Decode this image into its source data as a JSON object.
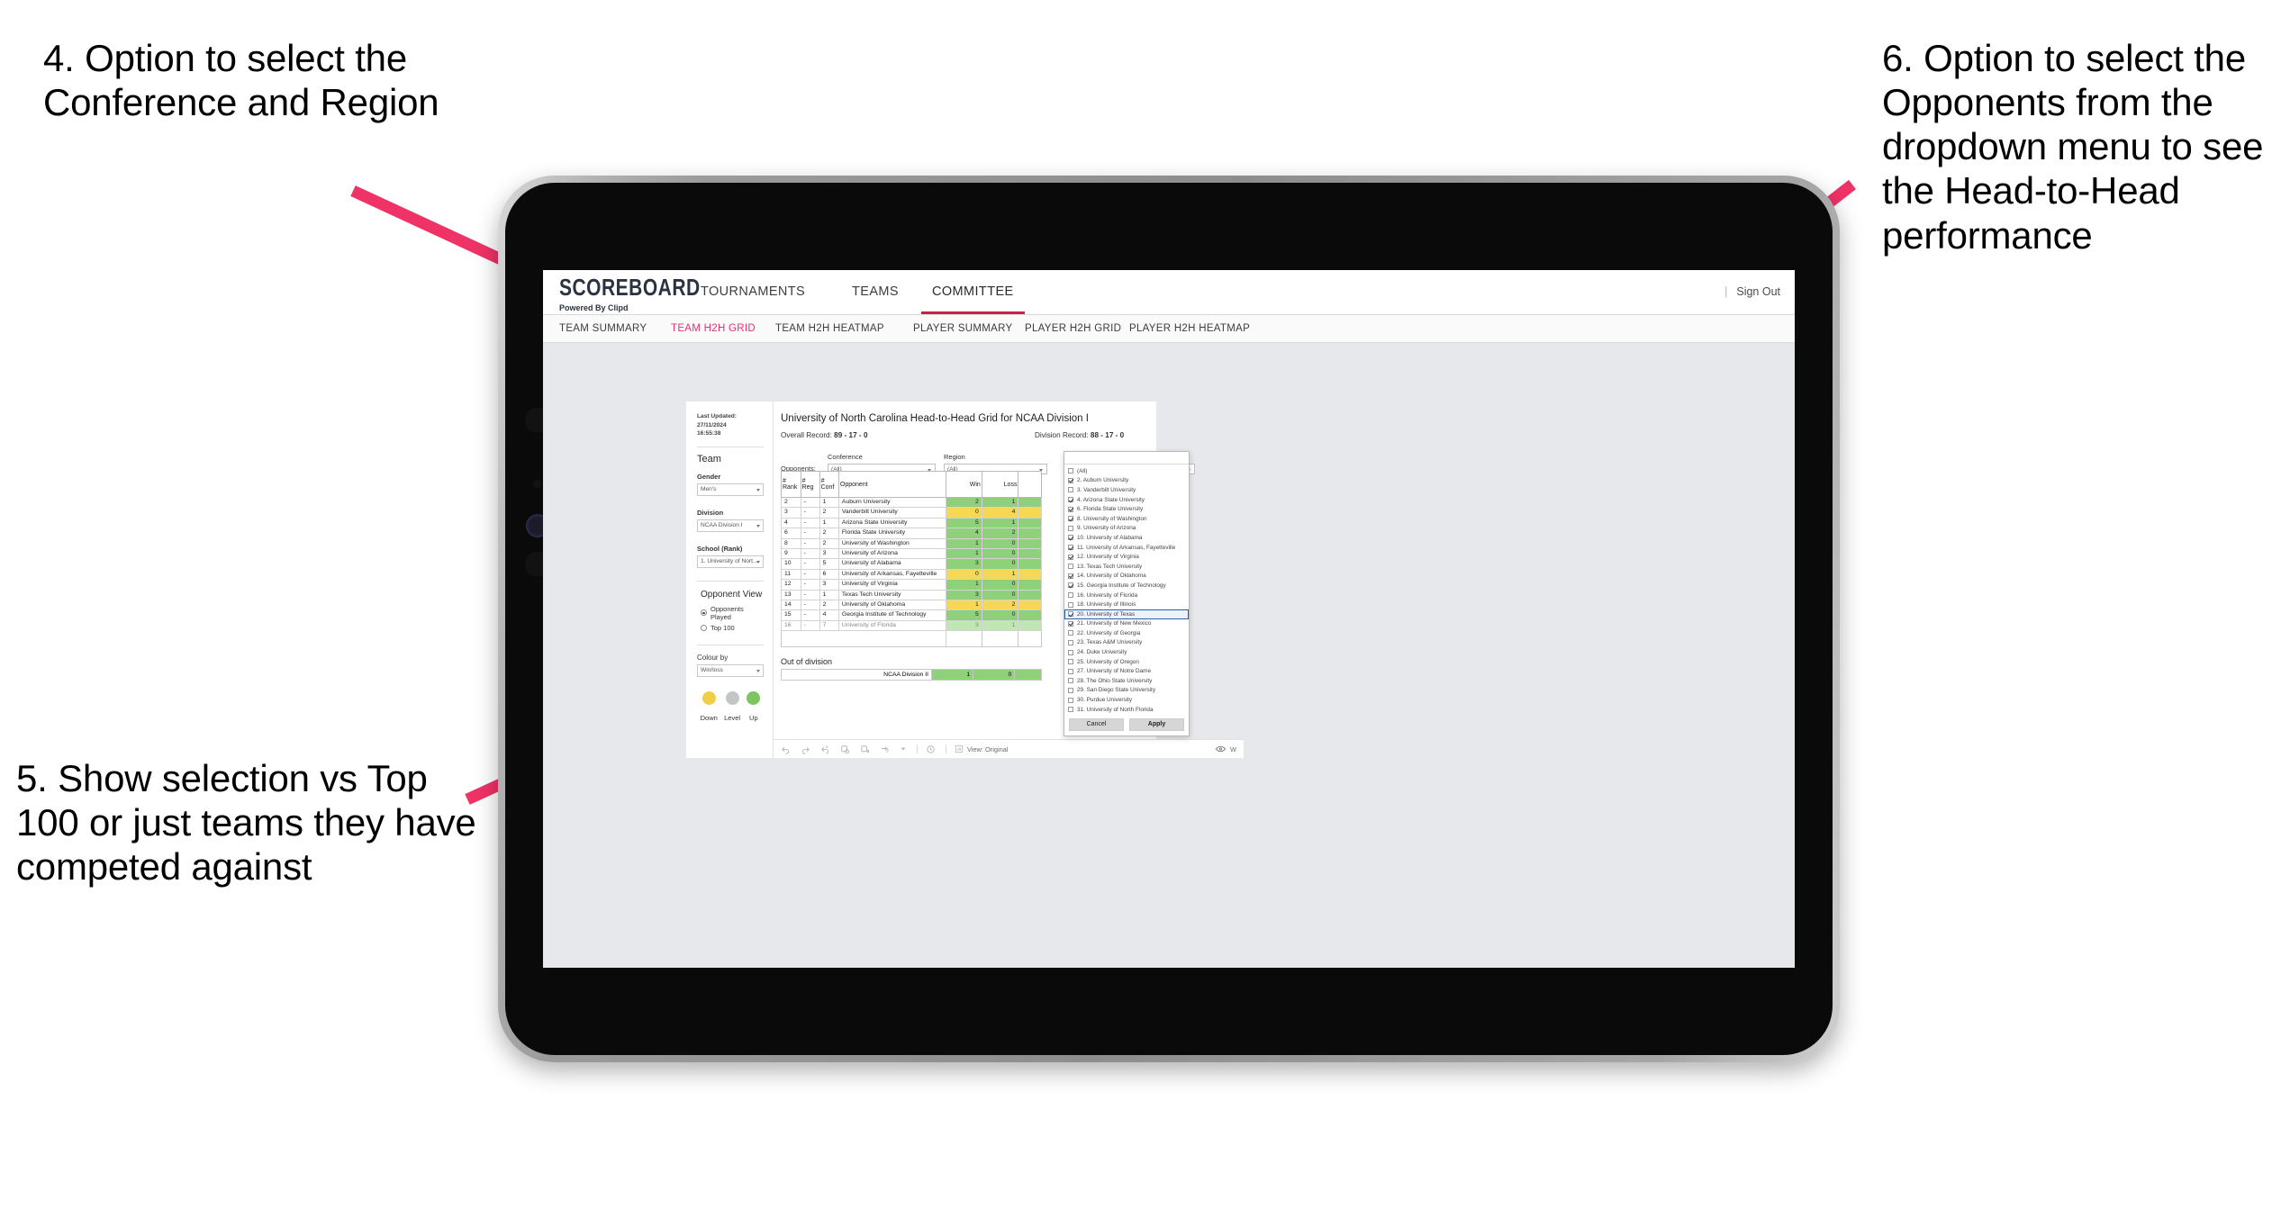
{
  "annotations": [
    {
      "id": "anno-4",
      "text": "4. Option to select the Conference and Region"
    },
    {
      "id": "anno-5",
      "text": "5. Show selection vs Top 100 or just teams they have competed against"
    },
    {
      "id": "anno-6",
      "text": "6. Option to select the Opponents from the dropdown menu to see the Head-to-Head performance"
    }
  ],
  "arrow_color": "#ef3366",
  "app": {
    "logo": {
      "main": "SCOREBOARD",
      "sub": "Powered By Clipd"
    },
    "nav": [
      {
        "label": "TOURNAMENTS",
        "active": false
      },
      {
        "label": "TEAMS",
        "active": false
      },
      {
        "label": "COMMITTEE",
        "active": true
      }
    ],
    "signout": "Sign Out",
    "subtabs": [
      {
        "label": "TEAM SUMMARY",
        "active": false
      },
      {
        "label": "TEAM H2H GRID",
        "active": true
      },
      {
        "label": "TEAM H2H HEATMAP",
        "active": false
      },
      {
        "label": "PLAYER SUMMARY",
        "active": false
      },
      {
        "label": "PLAYER H2H GRID",
        "active": false
      },
      {
        "label": "PLAYER H2H HEATMAP",
        "active": false
      }
    ]
  },
  "sidebar": {
    "last_updated_line1": "Last Updated: 27/11/2024",
    "last_updated_line2": "16:55:38",
    "team_title": "Team",
    "fields": [
      {
        "label": "Gender",
        "value": "Men's"
      },
      {
        "label": "Division",
        "value": "NCAA Division I"
      },
      {
        "label": "School (Rank)",
        "value": "1. University of Nort..."
      }
    ],
    "opponent_view_title": "Opponent View",
    "opponent_view_options": [
      {
        "label": "Opponents Played",
        "selected": true
      },
      {
        "label": "Top 100",
        "selected": false
      }
    ],
    "colour_by_label": "Colour by",
    "colour_by_value": "Win/loss",
    "legend": [
      {
        "label": "Down",
        "color": "#f2ce48"
      },
      {
        "label": "Level",
        "color": "#c3c5c7"
      },
      {
        "label": "Up",
        "color": "#7dc462"
      }
    ]
  },
  "viz": {
    "title": "University of North Carolina Head-to-Head Grid for NCAA Division I",
    "overall_record_label": "Overall Record:",
    "overall_record_value": "89 - 17 - 0",
    "division_record_label": "Division Record:",
    "division_record_value": "88 - 17 - 0",
    "opponents_label": "Opponents:",
    "filters": [
      {
        "label": "Conference",
        "value": "(All)"
      },
      {
        "label": "Region",
        "value": "(All)"
      },
      {
        "label": "Opponent",
        "value": "(All)"
      }
    ],
    "out_of_division_title": "Out of division"
  },
  "chart_data": {
    "type": "table",
    "title": "University of North Carolina Head-to-Head Grid for NCAA Division I",
    "columns": [
      "# Rank",
      "# Reg",
      "# Conf",
      "Opponent",
      "Win",
      "Loss"
    ],
    "column_header_lines": [
      [
        "#",
        "Rank"
      ],
      [
        "#",
        "Reg"
      ],
      [
        "#",
        "Conf"
      ],
      [
        "Opponent"
      ],
      [
        "Win"
      ],
      [
        "Loss"
      ]
    ],
    "rows": [
      {
        "rank": "2",
        "reg": "-",
        "conf": "1",
        "opponent": "Auburn University",
        "win": "2",
        "loss": "1",
        "color": "up"
      },
      {
        "rank": "3",
        "reg": "-",
        "conf": "2",
        "opponent": "Vanderbilt University",
        "win": "0",
        "loss": "4",
        "color": "down"
      },
      {
        "rank": "4",
        "reg": "-",
        "conf": "1",
        "opponent": "Arizona State University",
        "win": "5",
        "loss": "1",
        "color": "up"
      },
      {
        "rank": "6",
        "reg": "-",
        "conf": "2",
        "opponent": "Florida State University",
        "win": "4",
        "loss": "2",
        "color": "up"
      },
      {
        "rank": "8",
        "reg": "-",
        "conf": "2",
        "opponent": "University of Washington",
        "win": "1",
        "loss": "0",
        "color": "up"
      },
      {
        "rank": "9",
        "reg": "-",
        "conf": "3",
        "opponent": "University of Arizona",
        "win": "1",
        "loss": "0",
        "color": "up"
      },
      {
        "rank": "10",
        "reg": "-",
        "conf": "5",
        "opponent": "University of Alabama",
        "win": "3",
        "loss": "0",
        "color": "up"
      },
      {
        "rank": "11",
        "reg": "-",
        "conf": "6",
        "opponent": "University of Arkansas, Fayetteville",
        "win": "0",
        "loss": "1",
        "color": "down"
      },
      {
        "rank": "12",
        "reg": "-",
        "conf": "3",
        "opponent": "University of Virginia",
        "win": "1",
        "loss": "0",
        "color": "up"
      },
      {
        "rank": "13",
        "reg": "-",
        "conf": "1",
        "opponent": "Texas Tech University",
        "win": "3",
        "loss": "0",
        "color": "up"
      },
      {
        "rank": "14",
        "reg": "-",
        "conf": "2",
        "opponent": "University of Oklahoma",
        "win": "1",
        "loss": "2",
        "color": "down"
      },
      {
        "rank": "15",
        "reg": "-",
        "conf": "4",
        "opponent": "Georgia Institute of Technology",
        "win": "5",
        "loss": "0",
        "color": "up"
      },
      {
        "rank": "16",
        "reg": "-",
        "conf": "7",
        "opponent": "University of Florida",
        "win": "3",
        "loss": "1",
        "color": "up"
      }
    ],
    "out_of_division": [
      {
        "opponent": "NCAA Division II",
        "win": "1",
        "loss": "0",
        "color": "up"
      }
    ],
    "colors": {
      "up": "#8fd07a",
      "down": "#f6d757",
      "level": "#c3c5c7"
    }
  },
  "opponent_dropdown": {
    "items": [
      {
        "label": "(All)",
        "checked": false,
        "highlighted": false
      },
      {
        "label": "2. Auburn University",
        "checked": true,
        "highlighted": false
      },
      {
        "label": "3. Vanderbilt University",
        "checked": false,
        "highlighted": false
      },
      {
        "label": "4. Arizona State University",
        "checked": true,
        "highlighted": false
      },
      {
        "label": "6. Florida State University",
        "checked": true,
        "highlighted": false
      },
      {
        "label": "8. University of Washington",
        "checked": true,
        "highlighted": false
      },
      {
        "label": "9. University of Arizona",
        "checked": false,
        "highlighted": false
      },
      {
        "label": "10. University of Alabama",
        "checked": true,
        "highlighted": false
      },
      {
        "label": "11. University of Arkansas, Fayetteville",
        "checked": true,
        "highlighted": false
      },
      {
        "label": "12. University of Virginia",
        "checked": true,
        "highlighted": false
      },
      {
        "label": "13. Texas Tech University",
        "checked": false,
        "highlighted": false
      },
      {
        "label": "14. University of Oklahoma",
        "checked": true,
        "highlighted": false
      },
      {
        "label": "15. Georgia Institute of Technology",
        "checked": true,
        "highlighted": false
      },
      {
        "label": "16. University of Florida",
        "checked": false,
        "highlighted": false
      },
      {
        "label": "18. University of Illinois",
        "checked": false,
        "highlighted": false
      },
      {
        "label": "20. University of Texas",
        "checked": true,
        "highlighted": true
      },
      {
        "label": "21. University of New Mexico",
        "checked": true,
        "highlighted": false
      },
      {
        "label": "22. University of Georgia",
        "checked": false,
        "highlighted": false
      },
      {
        "label": "23. Texas A&M University",
        "checked": false,
        "highlighted": false
      },
      {
        "label": "24. Duke University",
        "checked": false,
        "highlighted": false
      },
      {
        "label": "25. University of Oregon",
        "checked": false,
        "highlighted": false
      },
      {
        "label": "27. University of Notre Dame",
        "checked": false,
        "highlighted": false
      },
      {
        "label": "28. The Ohio State University",
        "checked": false,
        "highlighted": false
      },
      {
        "label": "29. San Diego State University",
        "checked": false,
        "highlighted": false
      },
      {
        "label": "30. Purdue University",
        "checked": false,
        "highlighted": false
      },
      {
        "label": "31. University of North Florida",
        "checked": false,
        "highlighted": false
      }
    ],
    "cancel_label": "Cancel",
    "apply_label": "Apply"
  },
  "toolbar": {
    "view_label": "View: Original",
    "watermark_label": "W"
  }
}
